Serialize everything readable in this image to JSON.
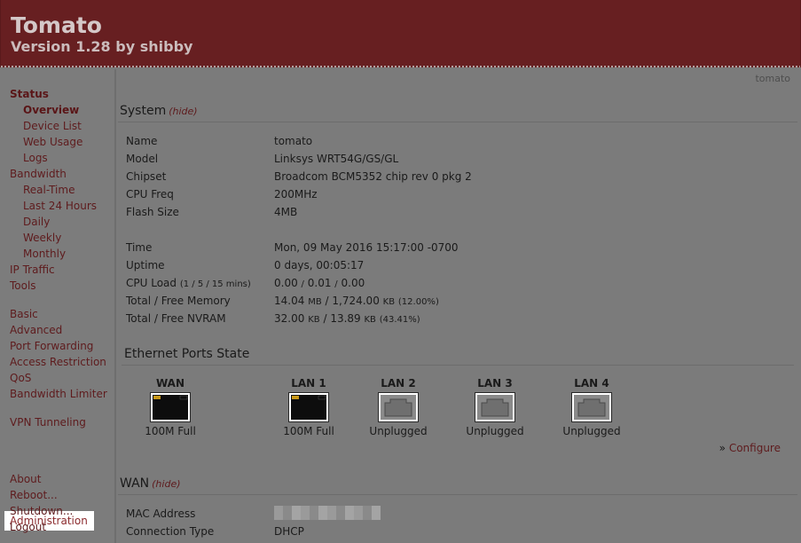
{
  "header": {
    "title": "Tomato",
    "version": "Version 1.28 by shibby"
  },
  "sidebar": {
    "status": "Status",
    "overview": "Overview",
    "device_list": "Device List",
    "web_usage": "Web Usage",
    "logs": "Logs",
    "bandwidth": "Bandwidth",
    "real_time": "Real-Time",
    "last_24_hours": "Last 24 Hours",
    "daily": "Daily",
    "weekly": "Weekly",
    "monthly": "Monthly",
    "ip_traffic": "IP Traffic",
    "tools": "Tools",
    "basic": "Basic",
    "advanced": "Advanced",
    "port_forwarding": "Port Forwarding",
    "access_restriction": "Access Restriction",
    "qos": "QoS",
    "bandwidth_limiter": "Bandwidth Limiter",
    "vpn_tunneling": "VPN Tunneling",
    "administration": "Administration",
    "about": "About",
    "reboot": "Reboot...",
    "shutdown": "Shutdown...",
    "logout": "Logout"
  },
  "main": {
    "hostname": "tomato",
    "system": {
      "title": "System",
      "hide": "(hide)",
      "name_label": "Name",
      "name_value": "tomato",
      "model_label": "Model",
      "model_value": "Linksys WRT54G/GS/GL",
      "chipset_label": "Chipset",
      "chipset_value": "Broadcom BCM5352 chip rev 0 pkg 2",
      "cpufreq_label": "CPU Freq",
      "cpufreq_value": "200MHz",
      "flash_label": "Flash Size",
      "flash_value": "4MB",
      "time_label": "Time",
      "time_value": "Mon, 09 May 2016 15:17:00 -0700",
      "uptime_label": "Uptime",
      "uptime_value": "0 days, 00:05:17",
      "cpuload_label": "CPU Load",
      "cpuload_label_small": "(1 / 5 / 15 mins)",
      "cpuload_v1": "0.00",
      "cpuload_v2": "0.01",
      "cpuload_v3": "0.00",
      "memory_label": "Total / Free Memory",
      "memory_total": "14.04",
      "memory_free": "1,724.00",
      "memory_pct": "(12.00%)",
      "nvram_label": "Total / Free NVRAM",
      "nvram_total": "32.00",
      "nvram_free": "13.89",
      "nvram_pct": "(43.41%)",
      "unit_mb": "MB",
      "unit_kb": "KB",
      "slash": "/"
    },
    "ports": {
      "title": "Ethernet Ports State",
      "items": [
        {
          "name": "WAN",
          "status": "100M Full"
        },
        {
          "name": "LAN 1",
          "status": "100M Full"
        },
        {
          "name": "LAN 2",
          "status": "Unplugged"
        },
        {
          "name": "LAN 3",
          "status": "Unplugged"
        },
        {
          "name": "LAN 4",
          "status": "Unplugged"
        }
      ],
      "configure_prefix": "»",
      "configure": "Configure"
    },
    "wan": {
      "title": "WAN",
      "hide": "(hide)",
      "mac_label": "MAC Address",
      "conn_label": "Connection Type",
      "conn_value": "DHCP"
    }
  },
  "colors": {
    "header_bg": "#671f21",
    "link": "#5e1b1d"
  }
}
